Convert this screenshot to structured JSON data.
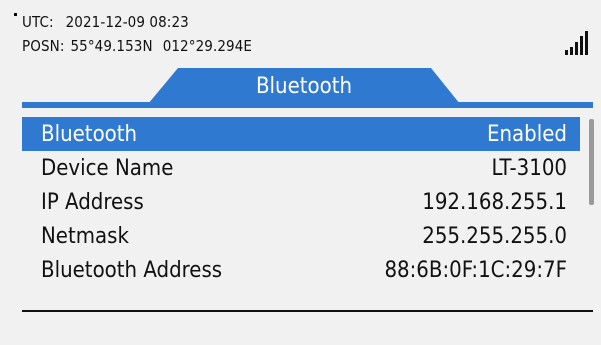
{
  "status": {
    "utc_label": "UTC:",
    "utc_value": "2021-12-09 08:23",
    "posn_label": "POSN:",
    "lat": "55°49.153N",
    "lon": "012°29.294E"
  },
  "tab": {
    "title": "Bluetooth"
  },
  "rows": [
    {
      "label": "Bluetooth",
      "value": "Enabled",
      "selected": true
    },
    {
      "label": "Device Name",
      "value": "LT-3100"
    },
    {
      "label": "IP Address",
      "value": "192.168.255.1"
    },
    {
      "label": "Netmask",
      "value": "255.255.255.0"
    },
    {
      "label": "Bluetooth Address",
      "value": "88:6B:0F:1C:29:7F"
    }
  ],
  "colors": {
    "accent": "#2f7ad0",
    "background": "#f1f1f1"
  },
  "icons": {
    "signal": "signal-strength-icon"
  }
}
